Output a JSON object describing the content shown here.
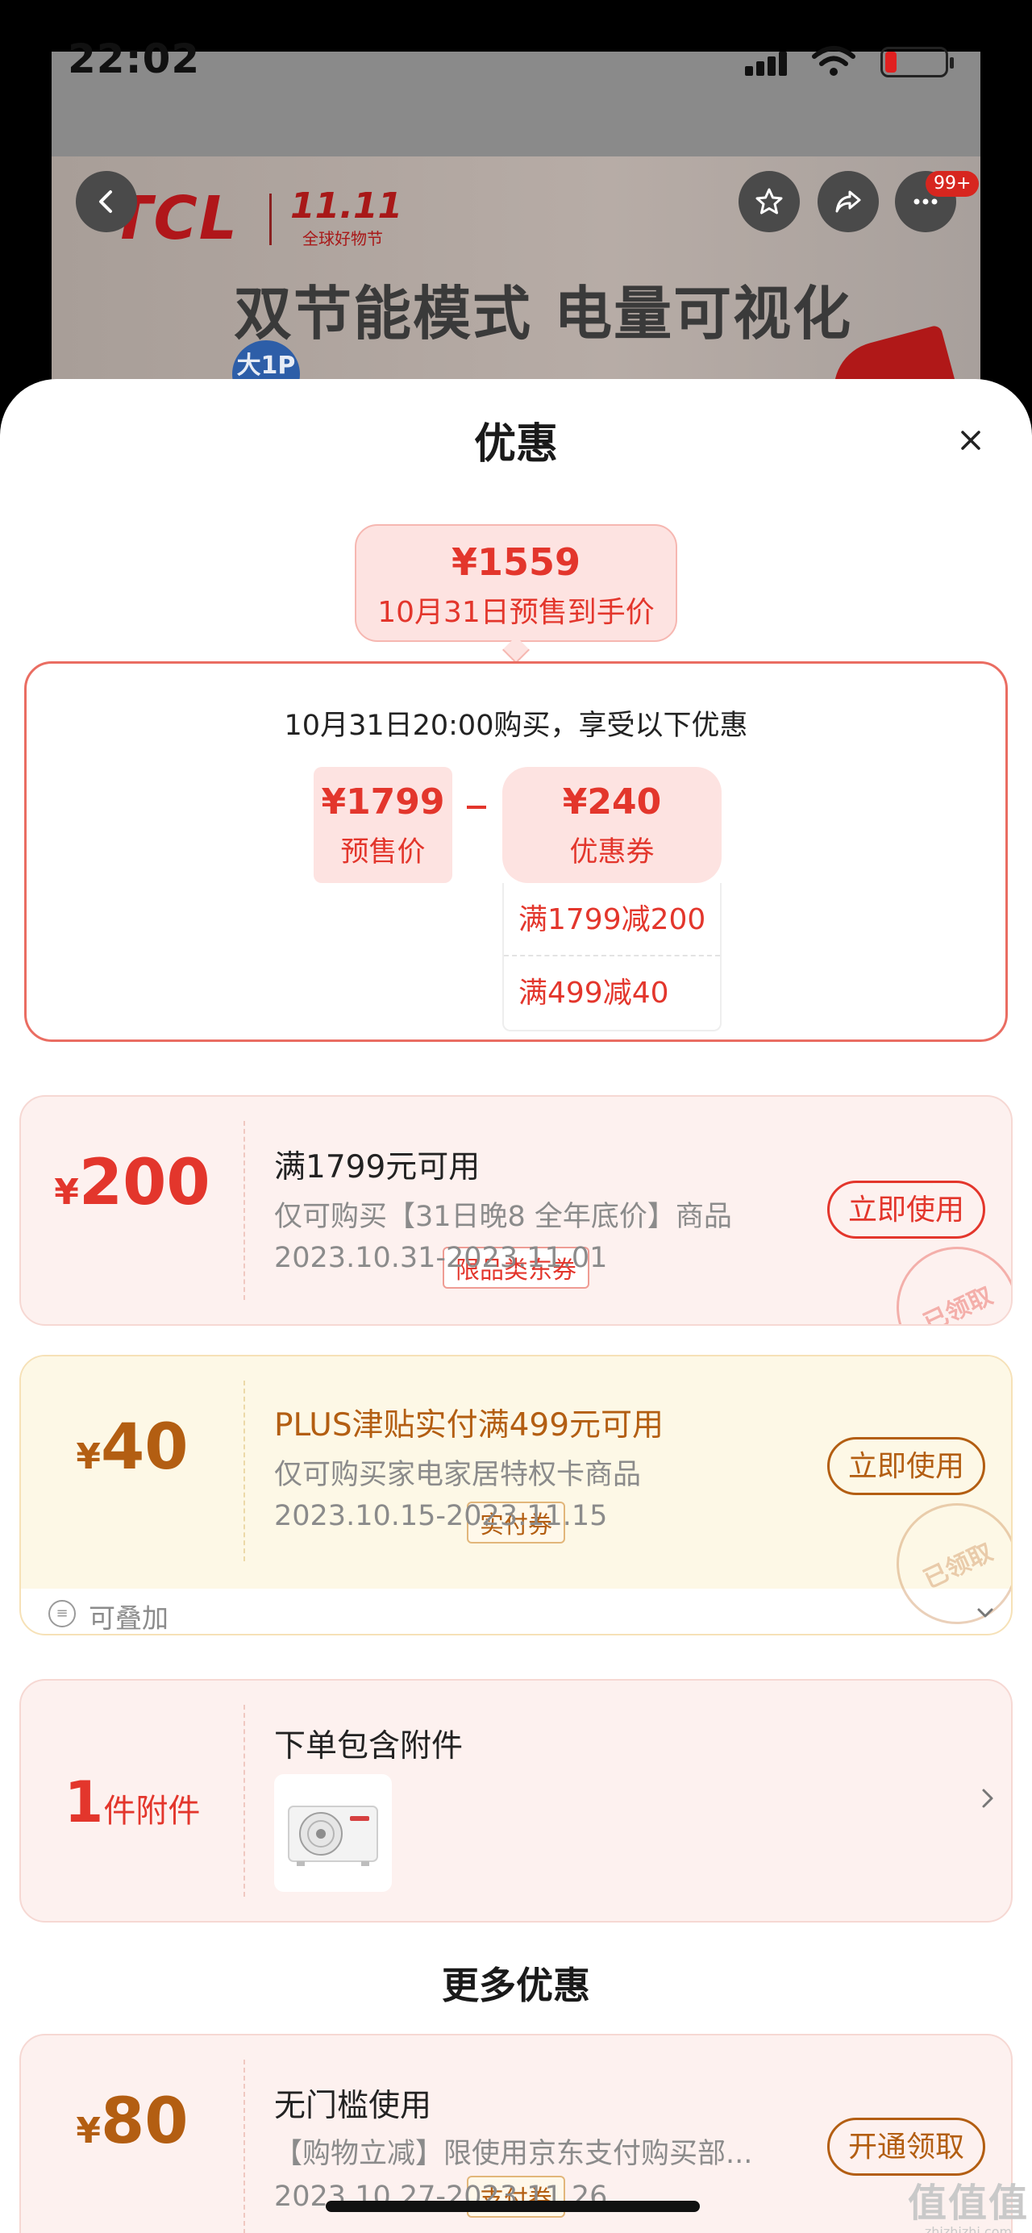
{
  "status_bar": {
    "time": "22:02"
  },
  "product_banner": {
    "brand": "TCL",
    "event_logo_big": "11.11",
    "event_logo_small": "全球好物节",
    "slogan": "双节能模式 电量可视化",
    "badge": "大1P",
    "cart_badge": "99+"
  },
  "sheet": {
    "title": "优惠",
    "final_price": {
      "amount": "¥1559",
      "label": "10月31日预售到手价"
    },
    "calc": {
      "headline": "10月31日20:00购买，享受以下优惠",
      "presale": {
        "value": "¥1799",
        "label": "预售价"
      },
      "coupon": {
        "value": "¥240",
        "label": "优惠券"
      },
      "coupon_items": [
        "满1799减200",
        "满499减40"
      ]
    },
    "coupons": [
      {
        "yen": "¥",
        "value": "200",
        "tag": "限品类东券",
        "title": "满1799元可用",
        "desc": "仅可购买【31日晚8 全年底价】商品",
        "period": "2023.10.31-2023.11.01",
        "button": "立即使用",
        "stamp": "已领取"
      },
      {
        "yen": "¥",
        "value": "40",
        "tag": "实付券",
        "title": "PLUS津贴实付满499元可用",
        "desc": "仅可购买家电家居特权卡商品",
        "period": "2023.10.15-2023.11.15",
        "button": "立即使用",
        "stamp": "已领取",
        "stack_label": "可叠加"
      }
    ],
    "attachment": {
      "count": "1",
      "unit": "件附件",
      "title": "下单包含附件"
    },
    "more_title": "更多优惠",
    "more_coupons": [
      {
        "yen": "¥",
        "value": "80",
        "tag": "支付券",
        "title": "无门槛使用",
        "desc": "【购物立减】限使用京东支付购买部...",
        "period": "2023.10.27-2023.11.26",
        "button": "开通领取"
      }
    ]
  },
  "watermark": {
    "text": "值值值",
    "url": "zhizhizhi.com"
  },
  "colors": {
    "accent_red": "#e3362c",
    "accent_gold": "#b35e12",
    "coupon_pink_bg": "#fdf1ef",
    "coupon_yellow_bg": "#fdf8e6"
  }
}
